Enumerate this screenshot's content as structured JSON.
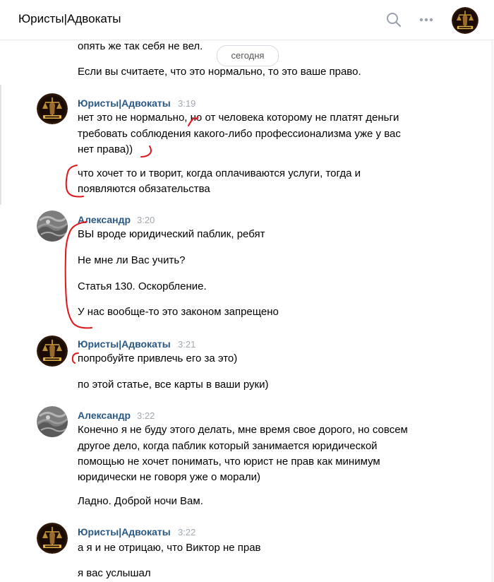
{
  "header": {
    "title": "Юристы|Адвокаты",
    "icons": [
      "search-icon",
      "more-icon",
      "avatar"
    ]
  },
  "date_separator": "сегодня",
  "prev_lines": [
    "опять же так себя не вел.",
    "Если вы считаете, что это нормально, то это ваше право."
  ],
  "messages": [
    {
      "author": "Юристы|Адвокаты",
      "time": "3:19",
      "lines": [
        "нет это не нормально, но от человека которому не платят деньги",
        "требовать соблюдения какого-либо профессионализма уже у вас",
        "нет права))",
        "что хочет то и творит, когда оплачиваются услуги, тогда и",
        "появляются обязательства"
      ]
    },
    {
      "author": "Александр",
      "time": "3:20",
      "lines": [
        "ВЫ вроде юридический паблик, ребят",
        "Не мне ли Вас учить?",
        "Статья 130. Оскорбление.",
        "У нас вообще-то это законом запрещено"
      ]
    },
    {
      "author": "Юристы|Адвокаты",
      "time": "3:21",
      "lines": [
        "попробуйте привлечь его за это)",
        "по этой статье, все карты в ваши руки)"
      ]
    },
    {
      "author": "Александр",
      "time": "3:22",
      "lines": [
        "Конечно я не буду этого делать, мне время свое дорого, но совсем",
        "другое дело, когда паблик который занимается юридической",
        "помощью не хочет понимать, что юрист не прав как минимум",
        "юридически не говоря уже о морали)",
        "Ладно. Доброй ночи Вам."
      ]
    },
    {
      "author": "Юристы|Адвокаты",
      "time": "3:22",
      "lines": [
        "а я и не отрицаю, что Виктор не прав",
        "я вас услышал"
      ]
    }
  ],
  "colors": {
    "author": "#2a5885",
    "time": "#a0a8b0",
    "annotation": "#e0161a",
    "logo_gold": "#d8a53a"
  }
}
